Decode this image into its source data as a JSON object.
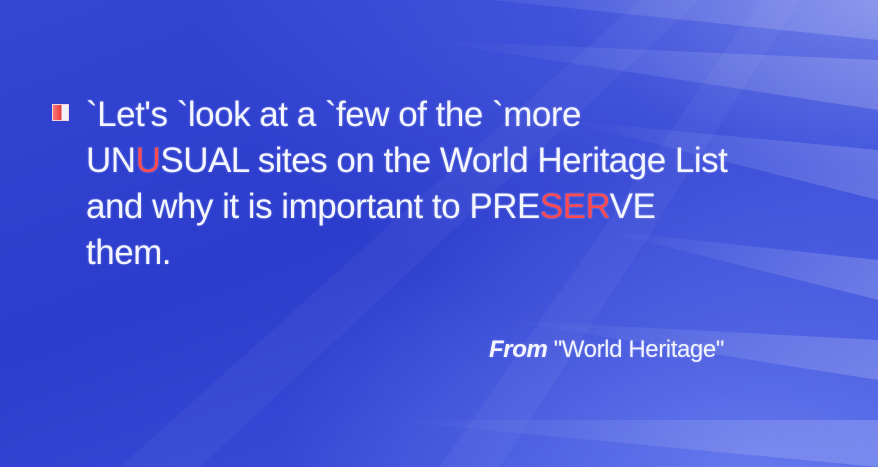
{
  "slide": {
    "bullet_icon": "square-bullet-icon",
    "body": {
      "line1": "`Let's `look at a `few of the `more",
      "line2_pre": "UN",
      "line2_hl": "U",
      "line2_mid": "SUAL sites on the World Heritage List",
      "line3_pre": "and why it is important to PRE",
      "line3_hl": "SER",
      "line3_post": "VE",
      "line4": "them."
    },
    "attribution": {
      "from": "From",
      "source": "\"World Heritage\""
    },
    "colors": {
      "background": "#2f3fd0",
      "text": "#f3f5ff",
      "highlight": "#ff4a52"
    }
  }
}
